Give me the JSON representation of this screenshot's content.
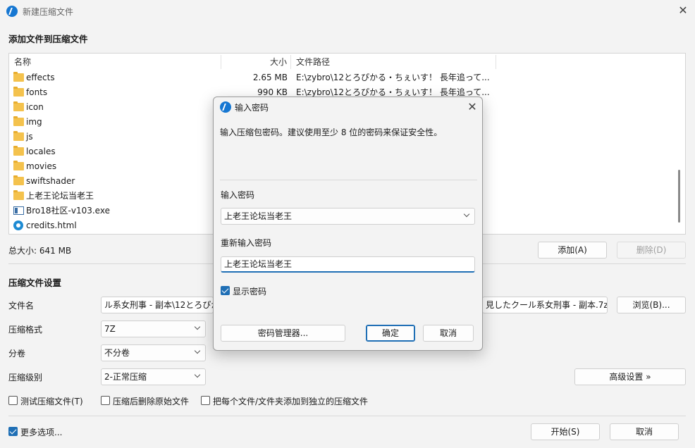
{
  "window": {
    "title": "新建压缩文件"
  },
  "add_section": {
    "title": "添加文件到压缩文件"
  },
  "list": {
    "columns": [
      "名称",
      "大小",
      "文件路径"
    ],
    "rows": [
      {
        "name": "effects",
        "size": "2.65 MB",
        "path": "E:\\zybro\\12とろぴかる・ちぇいす！ 長年追って...",
        "icon": "folder-icon"
      },
      {
        "name": "fonts",
        "size": "990 KB",
        "path": "E:\\zybro\\12とろぴかる・ちぇいす！ 長年追って...",
        "icon": "folder-icon"
      },
      {
        "name": "icon",
        "size": "",
        "path": "",
        "icon": "folder-icon"
      },
      {
        "name": "img",
        "size": "",
        "path": "",
        "icon": "folder-icon"
      },
      {
        "name": "js",
        "size": "",
        "path": "",
        "icon": "folder-icon"
      },
      {
        "name": "locales",
        "size": "",
        "path": "",
        "icon": "folder-icon"
      },
      {
        "name": "movies",
        "size": "",
        "path": "",
        "icon": "folder-icon"
      },
      {
        "name": "swiftshader",
        "size": "",
        "path": "",
        "icon": "folder-icon"
      },
      {
        "name": "上老王论坛当老王",
        "size": "",
        "path": "",
        "icon": "folder-icon"
      },
      {
        "name": "Bro18社区-v103.exe",
        "size": "",
        "path": "",
        "icon": "exe-icon"
      },
      {
        "name": "credits.html",
        "size": "",
        "path": "",
        "icon": "edge-html-icon"
      }
    ]
  },
  "total_size": "总大小: 641 MB",
  "buttons": {
    "add": "添加(A)",
    "delete": "删除(D)",
    "browse": "浏览(B)...",
    "advanced": "高级设置 »",
    "start": "开始(S)",
    "cancel": "取消"
  },
  "settings": {
    "title": "压缩文件设置",
    "filename_label": "文件名",
    "filename_left": "ル系女刑事 - 副本\\12とろぴか",
    "filename_right": "見したクール系女刑事 - 副本.7z",
    "format_label": "压缩格式",
    "format_value": "7Z",
    "split_label": "分卷",
    "split_value": "不分卷",
    "level_label": "压缩级别",
    "level_value": "2-正常压缩"
  },
  "checkboxes": {
    "test": "测试压缩文件(T)",
    "delete_after": "压缩后删除原始文件",
    "each_separate": "把每个文件/文件夹添加到独立的压缩文件",
    "more_options": "更多选项..."
  },
  "password_dialog": {
    "title": "输入密码",
    "hint": "输入压缩包密码。建议使用至少 8 位的密码来保证安全性。",
    "label_password": "输入密码",
    "password_value": "上老王论坛当老王",
    "label_reenter": "重新输入密码",
    "reenter_value": "上老王论坛当老王",
    "show_password": "显示密码",
    "manager_button": "密码管理器...",
    "ok_button": "确定",
    "cancel_button": "取消"
  }
}
